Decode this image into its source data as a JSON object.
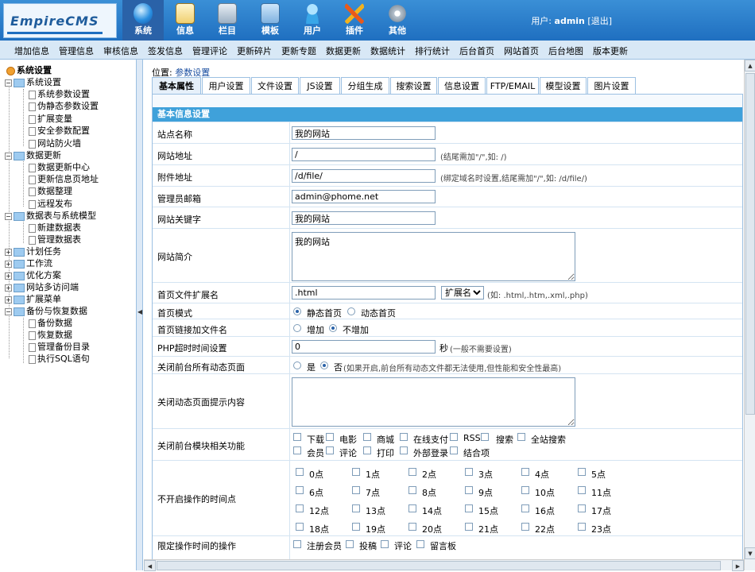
{
  "app": {
    "logo": "EmpireCMS"
  },
  "header": {
    "nav": [
      {
        "label": "系统",
        "icon": "globe-icon"
      },
      {
        "label": "信息",
        "icon": "notepad-icon"
      },
      {
        "label": "栏目",
        "icon": "folder-icon"
      },
      {
        "label": "模板",
        "icon": "window-icon"
      },
      {
        "label": "用户",
        "icon": "user-icon"
      },
      {
        "label": "插件",
        "icon": "tools-icon"
      },
      {
        "label": "其他",
        "icon": "gear-icon"
      }
    ],
    "user_label": "用户:",
    "user_name": "admin",
    "logout": "[退出]"
  },
  "subnav": [
    "增加信息",
    "管理信息",
    "审核信息",
    "签发信息",
    "管理评论",
    "更新碎片",
    "更新专题",
    "数据更新",
    "数据统计",
    "排行统计",
    "后台首页",
    "网站首页",
    "后台地图",
    "版本更新"
  ],
  "tree": {
    "root": "系统设置",
    "items": [
      "系统设置",
      "系统参数设置",
      "伪静态参数设置",
      "扩展变量",
      "安全参数配置",
      "网站防火墙",
      "数据更新",
      "数据更新中心",
      "更新信息页地址",
      "数据整理",
      "远程发布",
      "数据表与系统模型",
      "新建数据表",
      "管理数据表",
      "计划任务",
      "工作流",
      "优化方案",
      "网站多访问端",
      "扩展菜单",
      "备份与恢复数据",
      "备份数据",
      "恢复数据",
      "管理备份目录",
      "执行SQL语句"
    ]
  },
  "location": {
    "label": "位置:",
    "link": "参数设置"
  },
  "tabs": [
    "基本属性",
    "用户设置",
    "文件设置",
    "JS设置",
    "分组生成",
    "搜索设置",
    "信息设置",
    "FTP/EMAIL",
    "模型设置",
    "图片设置"
  ],
  "panel": {
    "title": "基本信息设置",
    "site_name": {
      "label": "站点名称",
      "value": "我的网站"
    },
    "site_url": {
      "label": "网站地址",
      "value": "/",
      "hint": "(结尾需加\"/\",如: /)"
    },
    "attach_url": {
      "label": "附件地址",
      "value": "/d/file/",
      "hint": "(绑定域名时设置,结尾需加\"/\",如: /d/file/)"
    },
    "admin_email": {
      "label": "管理员邮箱",
      "value": "admin@phome.net"
    },
    "keywords": {
      "label": "网站关键字",
      "value": "我的网站"
    },
    "intro": {
      "label": "网站简介",
      "value": "我的网站"
    },
    "index_ext": {
      "label": "首页文件扩展名",
      "value": ".html",
      "select": "扩展名",
      "hint": "(如: .html,.htm,.xml,.php)"
    },
    "index_mode": {
      "label": "首页模式",
      "opt1": "静态首页",
      "opt2": "动态首页"
    },
    "index_link": {
      "label": "首页链接加文件名",
      "opt1": "增加",
      "opt2": "不增加"
    },
    "php_timeout": {
      "label": "PHP超时时间设置",
      "value": "0",
      "unit": "秒",
      "hint": "(一般不需要设置)"
    },
    "close_dynamic": {
      "label": "关闭前台所有动态页面",
      "opt1": "是",
      "opt2": "否",
      "hint": "(如果开启,前台所有动态文件都无法使用,但性能和安全性最高)"
    },
    "close_msg": {
      "label": "关闭动态页面提示内容",
      "value": ""
    },
    "close_modules": {
      "label": "关闭前台模块相关功能",
      "items": [
        "下载",
        "电影",
        "商城",
        "在线支付",
        "RSS",
        "搜索",
        "全站搜索",
        "会员",
        "评论",
        "打印",
        "外部登录",
        "结合项"
      ]
    },
    "no_hours": {
      "label": "不开启操作的时间点",
      "items": [
        "0点",
        "1点",
        "2点",
        "3点",
        "4点",
        "5点",
        "6点",
        "7点",
        "8点",
        "9点",
        "10点",
        "11点",
        "12点",
        "13点",
        "14点",
        "15点",
        "16点",
        "17点",
        "18点",
        "19点",
        "20点",
        "21点",
        "22点",
        "23点"
      ]
    },
    "limit_ops": {
      "label": "限定操作时间的操作",
      "items": [
        "注册会员",
        "投稿",
        "评论",
        "留言板"
      ]
    }
  },
  "colors": {
    "header": "#1f6fc0",
    "panel_title": "#3fa1da",
    "subnav": "#d8e8f6"
  }
}
